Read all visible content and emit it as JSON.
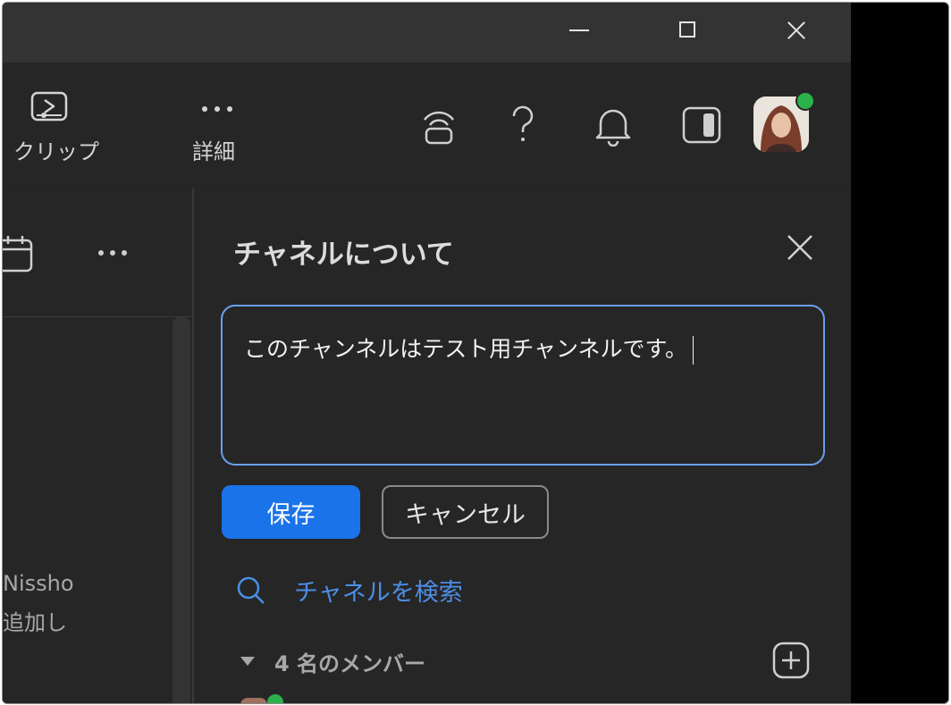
{
  "toolbar": {
    "clip_label": "クリップ",
    "more_label": "詳細"
  },
  "left_pane": {
    "text_line1": "Nissho",
    "text_line2": "追加し"
  },
  "panel": {
    "title": "チャネルについて",
    "description_value": "このチャンネルはテスト用チャンネルです。",
    "save_label": "保存",
    "cancel_label": "キャンセル",
    "search_label": "チャネルを検索",
    "members_label": "4 名のメンバー"
  },
  "colors": {
    "accent": "#1a73e8",
    "link": "#4c8ee6",
    "presence": "#2bb24c"
  }
}
